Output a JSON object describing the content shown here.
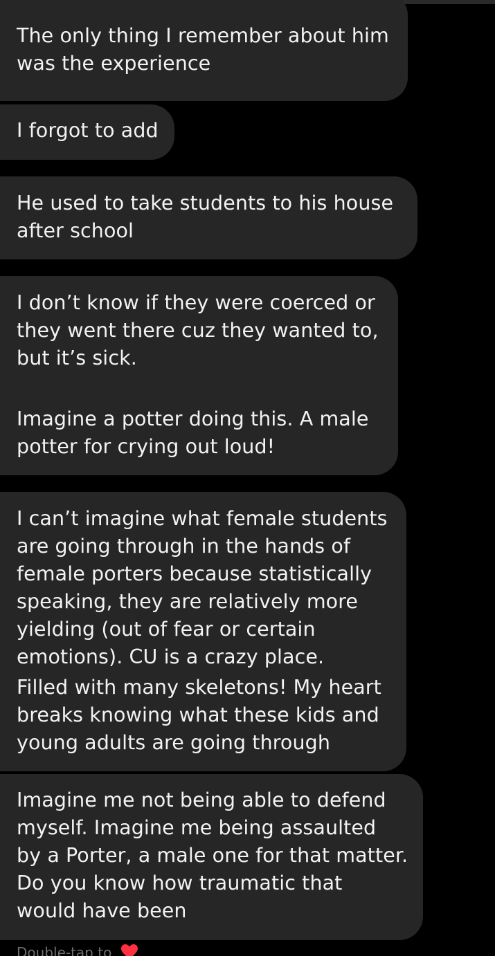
{
  "messages": [
    {
      "lines": [
        "The only thing I remember about him",
        "was the experience"
      ]
    },
    {
      "lines": [
        "I forgot to add"
      ]
    },
    {
      "lines": [
        "He used to take students to his house",
        "after school"
      ]
    },
    {
      "paragraphs": [
        [
          "I don’t know if they were coerced or",
          "they went there cuz they wanted to,",
          "but it’s sick."
        ],
        [
          "Imagine a potter doing this. A male",
          "potter for crying out loud!"
        ]
      ]
    },
    {
      "lines": [
        "I can’t imagine what female students",
        "are going through in the hands of",
        "female porters because statistically",
        "speaking, they are relatively more",
        "yielding (out of fear or certain",
        "emotions). CU is a crazy place.",
        "Filled with many skeletons! My heart",
        "breaks knowing what these kids and",
        "young adults are going through"
      ]
    },
    {
      "lines": [
        "Imagine me not being able to defend",
        "myself. Imagine me being assaulted",
        "by a Porter, a male one for that matter.",
        "Do you know how traumatic that",
        "would have been"
      ]
    }
  ],
  "footer": {
    "hint_text": "Double-tap to",
    "icon": "heart-icon",
    "heart_color": "#ff3040"
  },
  "colors": {
    "background": "#000000",
    "bubble": "#262626",
    "text": "#f2f2f2"
  }
}
